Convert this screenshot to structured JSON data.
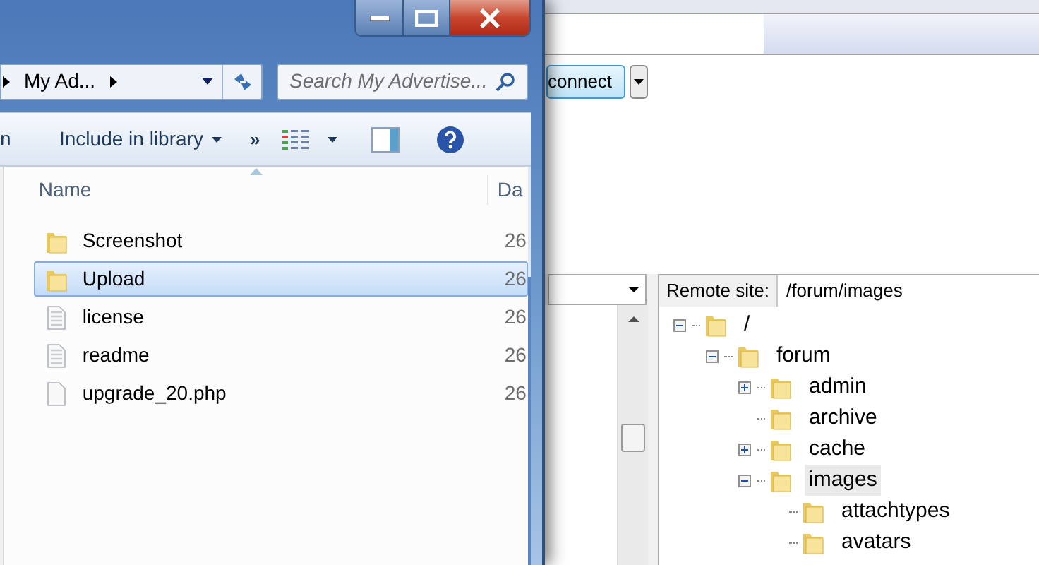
{
  "explorer": {
    "breadcrumb": "My Ad...",
    "search": {
      "placeholder": "Search My Advertise..."
    },
    "toolbar": {
      "cut_item": "n",
      "include": "Include in library",
      "more": "»"
    },
    "columns": [
      "Name",
      "Da"
    ],
    "rows": [
      {
        "name": "Screenshot",
        "kind": "folder",
        "date": "26",
        "selected": false
      },
      {
        "name": "Upload",
        "kind": "folder",
        "date": "26",
        "selected": true
      },
      {
        "name": "license",
        "kind": "text",
        "date": "26",
        "selected": false
      },
      {
        "name": "readme",
        "kind": "text",
        "date": "26",
        "selected": false
      },
      {
        "name": "upgrade_20.php",
        "kind": "file",
        "date": "26",
        "selected": false
      }
    ]
  },
  "filezilla": {
    "quickconnect": "connect",
    "remote_label": "Remote site:",
    "remote_path": "/forum/images",
    "tree": [
      {
        "label": "/",
        "expanded": true,
        "selected": false,
        "children": [
          {
            "label": "forum",
            "expanded": true,
            "selected": false,
            "children": [
              {
                "label": "admin",
                "expanded": false,
                "selected": false
              },
              {
                "label": "archive",
                "selected": false
              },
              {
                "label": "cache",
                "expanded": false,
                "selected": false
              },
              {
                "label": "images",
                "expanded": true,
                "selected": true,
                "children": [
                  {
                    "label": "attachtypes",
                    "selected": false
                  },
                  {
                    "label": "avatars",
                    "selected": false
                  }
                ]
              }
            ]
          }
        ]
      }
    ]
  }
}
